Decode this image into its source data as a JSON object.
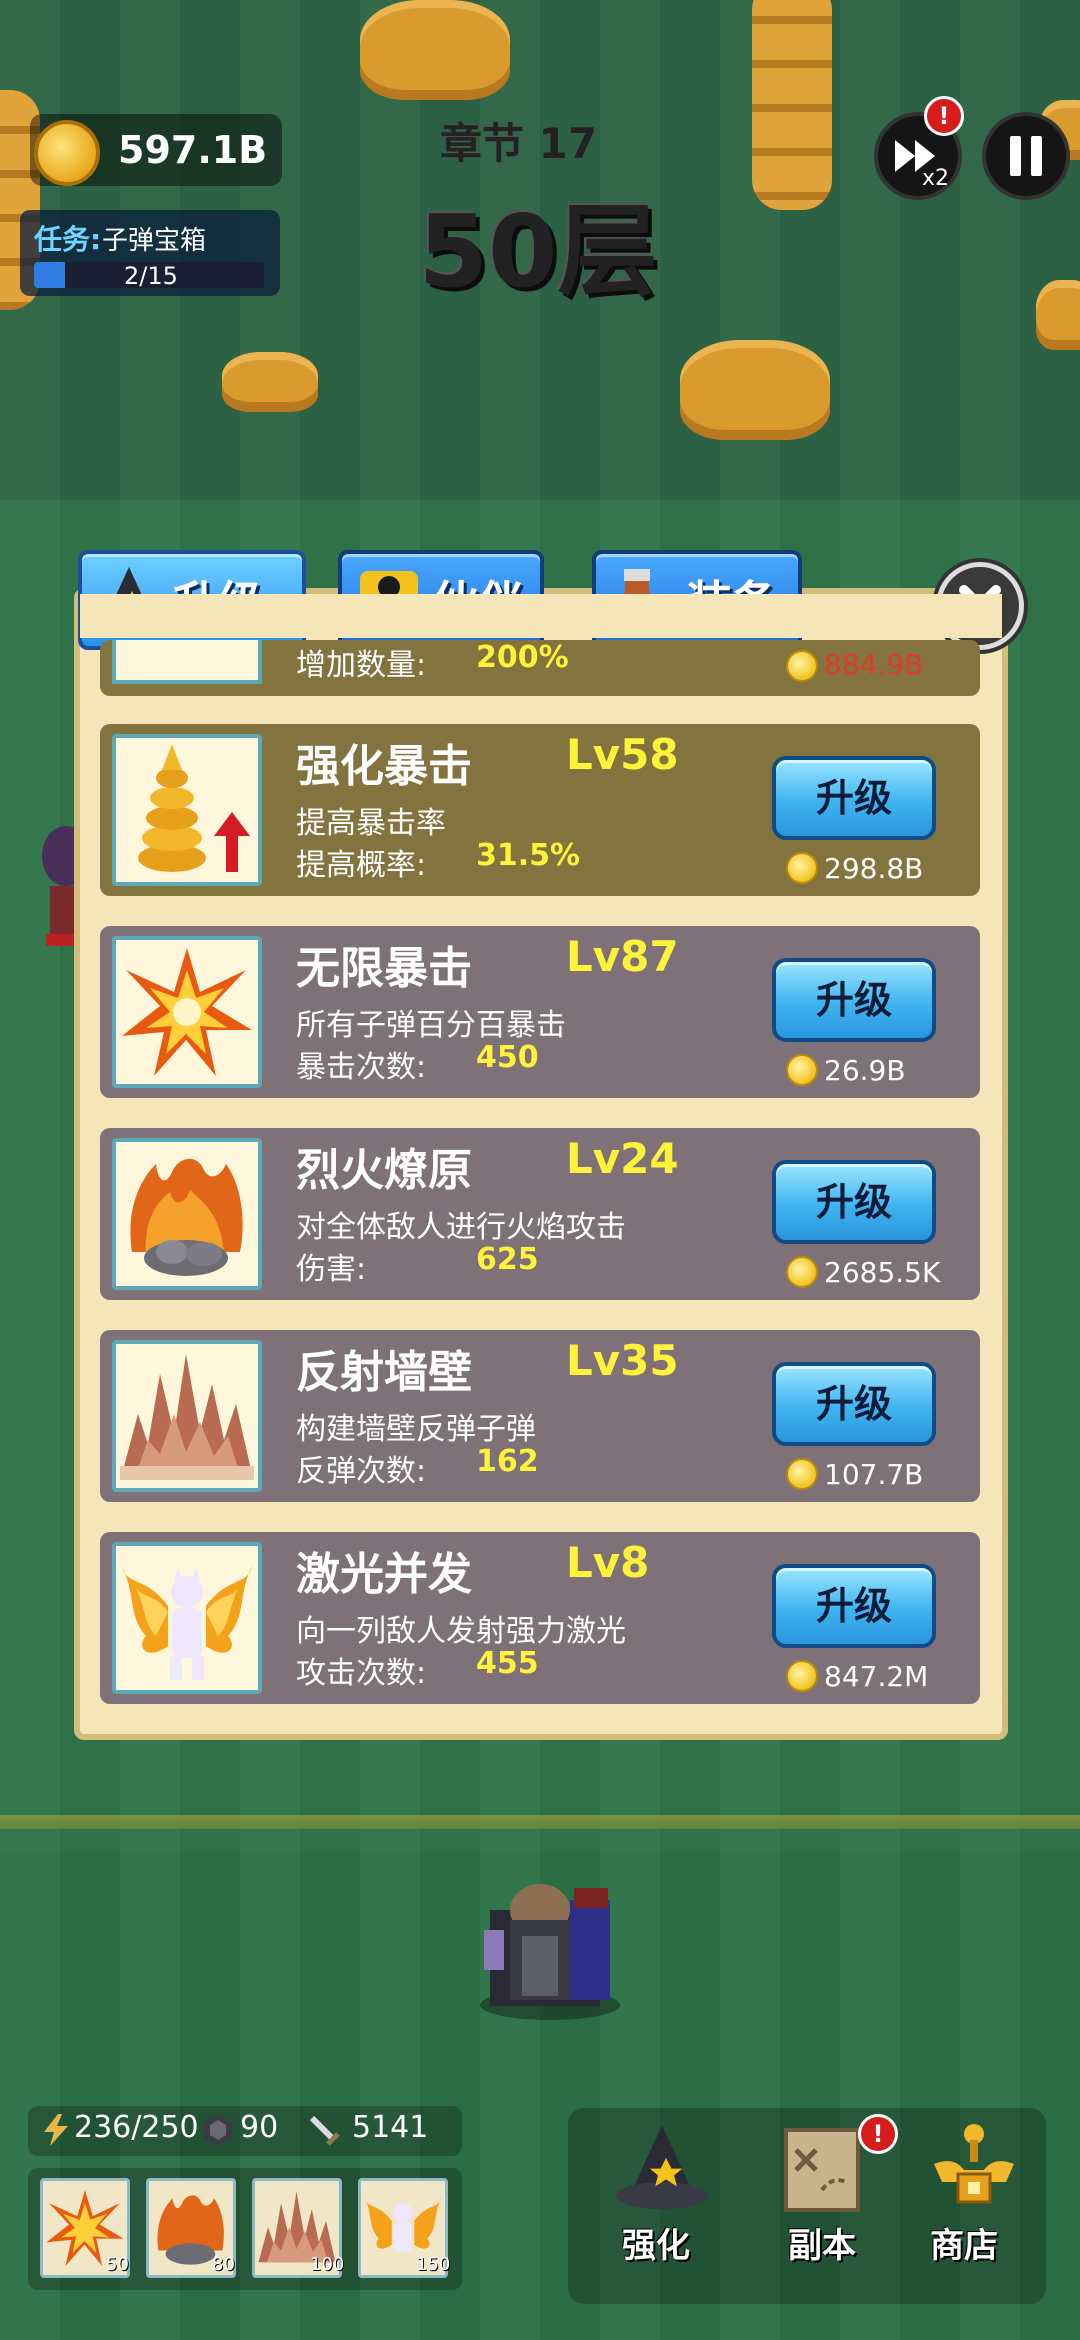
{
  "hud": {
    "coins": "597.1B",
    "task_label": "任务:",
    "task_name": "子弹宝箱",
    "task_progress": "2/15",
    "task_fraction": 0.1333,
    "chapter": "章节 17",
    "floor": "50层",
    "speed_label": "x2",
    "speed_badge": "!"
  },
  "tabs": [
    {
      "label": "升级",
      "icon": "wizard-hat-icon",
      "active": true
    },
    {
      "label": "伙伴",
      "icon": "companion-icon",
      "active": false
    },
    {
      "label": "装备",
      "icon": "boot-icon",
      "active": false
    }
  ],
  "partial_card": {
    "stat_label": "增加数量:",
    "stat_value": "200%",
    "cost": "884.9B"
  },
  "skills": [
    {
      "name": "强化暴击",
      "level": "Lv58",
      "desc": "提高暴击率",
      "stat_label": "提高概率:",
      "stat_value": "31.5%",
      "button": "升级",
      "cost": "298.8B",
      "icon": "crit-boost-icon"
    },
    {
      "name": "无限暴击",
      "level": "Lv87",
      "desc": "所有子弹百分百暴击",
      "stat_label": "暴击次数:",
      "stat_value": "450",
      "button": "升级",
      "cost": "26.9B",
      "icon": "burst-icon"
    },
    {
      "name": "烈火燎原",
      "level": "Lv24",
      "desc": "对全体敌人进行火焰攻击",
      "stat_label": "伤害:",
      "stat_value": "625",
      "button": "升级",
      "cost": "2685.5K",
      "icon": "fire-rock-icon"
    },
    {
      "name": "反射墙壁",
      "level": "Lv35",
      "desc": "构建墙壁反弹子弹",
      "stat_label": "反弹次数:",
      "stat_value": "162",
      "button": "升级",
      "cost": "107.7B",
      "icon": "spike-wall-icon"
    },
    {
      "name": "激光并发",
      "level": "Lv8",
      "desc": "向一列敌人发射强力激光",
      "stat_label": "攻击次数:",
      "stat_value": "455",
      "button": "升级",
      "cost": "847.2M",
      "icon": "winged-angel-icon"
    }
  ],
  "resources": {
    "energy": "236/250",
    "ore": "90",
    "attack": "5141"
  },
  "skill_tray": [
    {
      "icon": "burst-icon",
      "cost": "50"
    },
    {
      "icon": "fire-rock-icon",
      "cost": "80"
    },
    {
      "icon": "spike-wall-icon",
      "cost": "100"
    },
    {
      "icon": "winged-angel-icon",
      "cost": "150"
    }
  ],
  "nav": [
    {
      "label": "强化",
      "icon": "wizard-hat-icon"
    },
    {
      "label": "副本",
      "icon": "map-scroll-icon",
      "badge": "!"
    },
    {
      "label": "商店",
      "icon": "shop-icon"
    }
  ],
  "colors": {
    "level_yellow": "#fff23a",
    "button_blue": "#3fb4f0",
    "cost_red": "#e23a2a"
  }
}
